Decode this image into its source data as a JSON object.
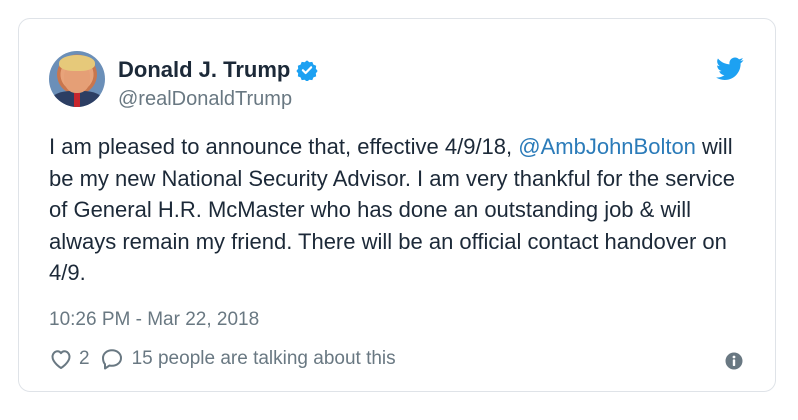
{
  "author": {
    "name": "Donald J. Trump",
    "handle": "@realDonaldTrump",
    "verified": true
  },
  "tweet": {
    "text_before": "I am pleased to announce that, effective 4/9/18, ",
    "mention": "@AmbJohnBolton",
    "text_after": " will be my new National Security Advisor. I am very thankful for the service of General H.R. McMaster who has done an outstanding job & will always remain my friend. There will be an official contact handover on 4/9.",
    "timestamp": "10:26 PM - Mar 22, 2018"
  },
  "actions": {
    "like_count": "2",
    "talking_text": "15 people are talking about this"
  },
  "icons": {
    "verified": "verified-badge-icon",
    "brand": "twitter-bird-icon",
    "like": "heart-icon",
    "reply": "speech-bubble-icon",
    "info": "info-icon"
  },
  "colors": {
    "link": "#2b7bb9",
    "brand": "#1da1f2",
    "text": "#1c2938",
    "muted": "#697882"
  }
}
